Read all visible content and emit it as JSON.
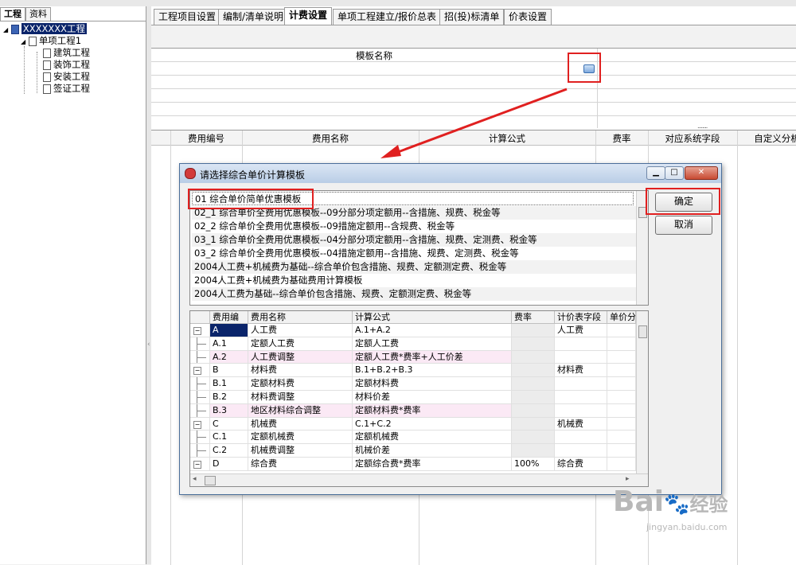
{
  "left_panel": {
    "tabs": [
      "工程",
      "资料"
    ],
    "tree": [
      {
        "label": "XXXXXXX工程",
        "selected": true
      },
      {
        "label": "单项工程1"
      },
      {
        "label": "建筑工程"
      },
      {
        "label": "装饰工程"
      },
      {
        "label": "安装工程"
      },
      {
        "label": "签证工程"
      }
    ]
  },
  "main": {
    "tabs": [
      "工程项目设置",
      "编制/清单说明",
      "计费设置",
      "单项工程建立/报价总表",
      "招(投)标清单",
      "价表设置"
    ],
    "active_tab": 2,
    "template_header": "模板名称",
    "columns": [
      "费用编号",
      "费用名称",
      "计算公式",
      "费率",
      "对应系统字段",
      "自定义分析"
    ]
  },
  "dialog": {
    "title": "请选择综合单价计算模板",
    "ok_label": "确定",
    "cancel_label": "取消",
    "templates": [
      "01 综合单价简单优惠模板",
      "02_1 综合单价全费用优惠模板--09分部分项定额用--含措施、规费、税金等",
      "02_2 综合单价全费用优惠模板--09措施定额用--含规费、税金等",
      "03_1 综合单价全费用优惠模板--04分部分项定额用--含措施、规费、定测费、税金等",
      "03_2 综合单价全费用优惠模板--04措施定额用--含措施、规费、定测费、税金等",
      "2004人工费+机械费为基础--综合单价包含措施、规费、定额测定费、税金等",
      "2004人工费+机械费为基础费用计算模板",
      "2004人工费为基础--综合单价包含措施、规费、定额测定费、税金等"
    ],
    "table_headers": [
      "费用编",
      "费用名称",
      "计算公式",
      "费率",
      "计价表字段",
      "单价分"
    ],
    "rows": [
      {
        "code": "A",
        "name": "人工费",
        "formula": "A.1+A.2",
        "rate": "",
        "field": "人工费",
        "level": 0,
        "highlight": ""
      },
      {
        "code": "A.1",
        "name": "定额人工费",
        "formula": "定额人工费",
        "rate": "",
        "field": "",
        "level": 1,
        "highlight": ""
      },
      {
        "code": "A.2",
        "name": "人工费调整",
        "formula": "定额人工费*费率+人工价差",
        "rate": "",
        "field": "",
        "level": 1,
        "highlight": "pink"
      },
      {
        "code": "B",
        "name": "材料费",
        "formula": "B.1+B.2+B.3",
        "rate": "",
        "field": "材料费",
        "level": 0,
        "highlight": ""
      },
      {
        "code": "B.1",
        "name": "定额材料费",
        "formula": "定额材料费",
        "rate": "",
        "field": "",
        "level": 1,
        "highlight": ""
      },
      {
        "code": "B.2",
        "name": "材料费调整",
        "formula": "材料价差",
        "rate": "",
        "field": "",
        "level": 1,
        "highlight": ""
      },
      {
        "code": "B.3",
        "name": "地区材料综合调整",
        "formula": "定额材料费*费率",
        "rate": "",
        "field": "",
        "level": 1,
        "highlight": "pink"
      },
      {
        "code": "C",
        "name": "机械费",
        "formula": "C.1+C.2",
        "rate": "",
        "field": "机械费",
        "level": 0,
        "highlight": ""
      },
      {
        "code": "C.1",
        "name": "定额机械费",
        "formula": "定额机械费",
        "rate": "",
        "field": "",
        "level": 1,
        "highlight": ""
      },
      {
        "code": "C.2",
        "name": "机械费调整",
        "formula": "机械价差",
        "rate": "",
        "field": "",
        "level": 1,
        "highlight": ""
      },
      {
        "code": "D",
        "name": "综合费",
        "formula": "定额综合费*费率",
        "rate": "100%",
        "field": "综合费",
        "level": 0,
        "highlight": ""
      }
    ]
  },
  "watermark": {
    "brand": "Bai",
    "brand2": "经验",
    "url": "jingyan.baidu.com"
  },
  "colors": {
    "annotation_red": "#e02020",
    "selected_tree": "#0a246a",
    "pink_row": "#fbe9f5"
  }
}
